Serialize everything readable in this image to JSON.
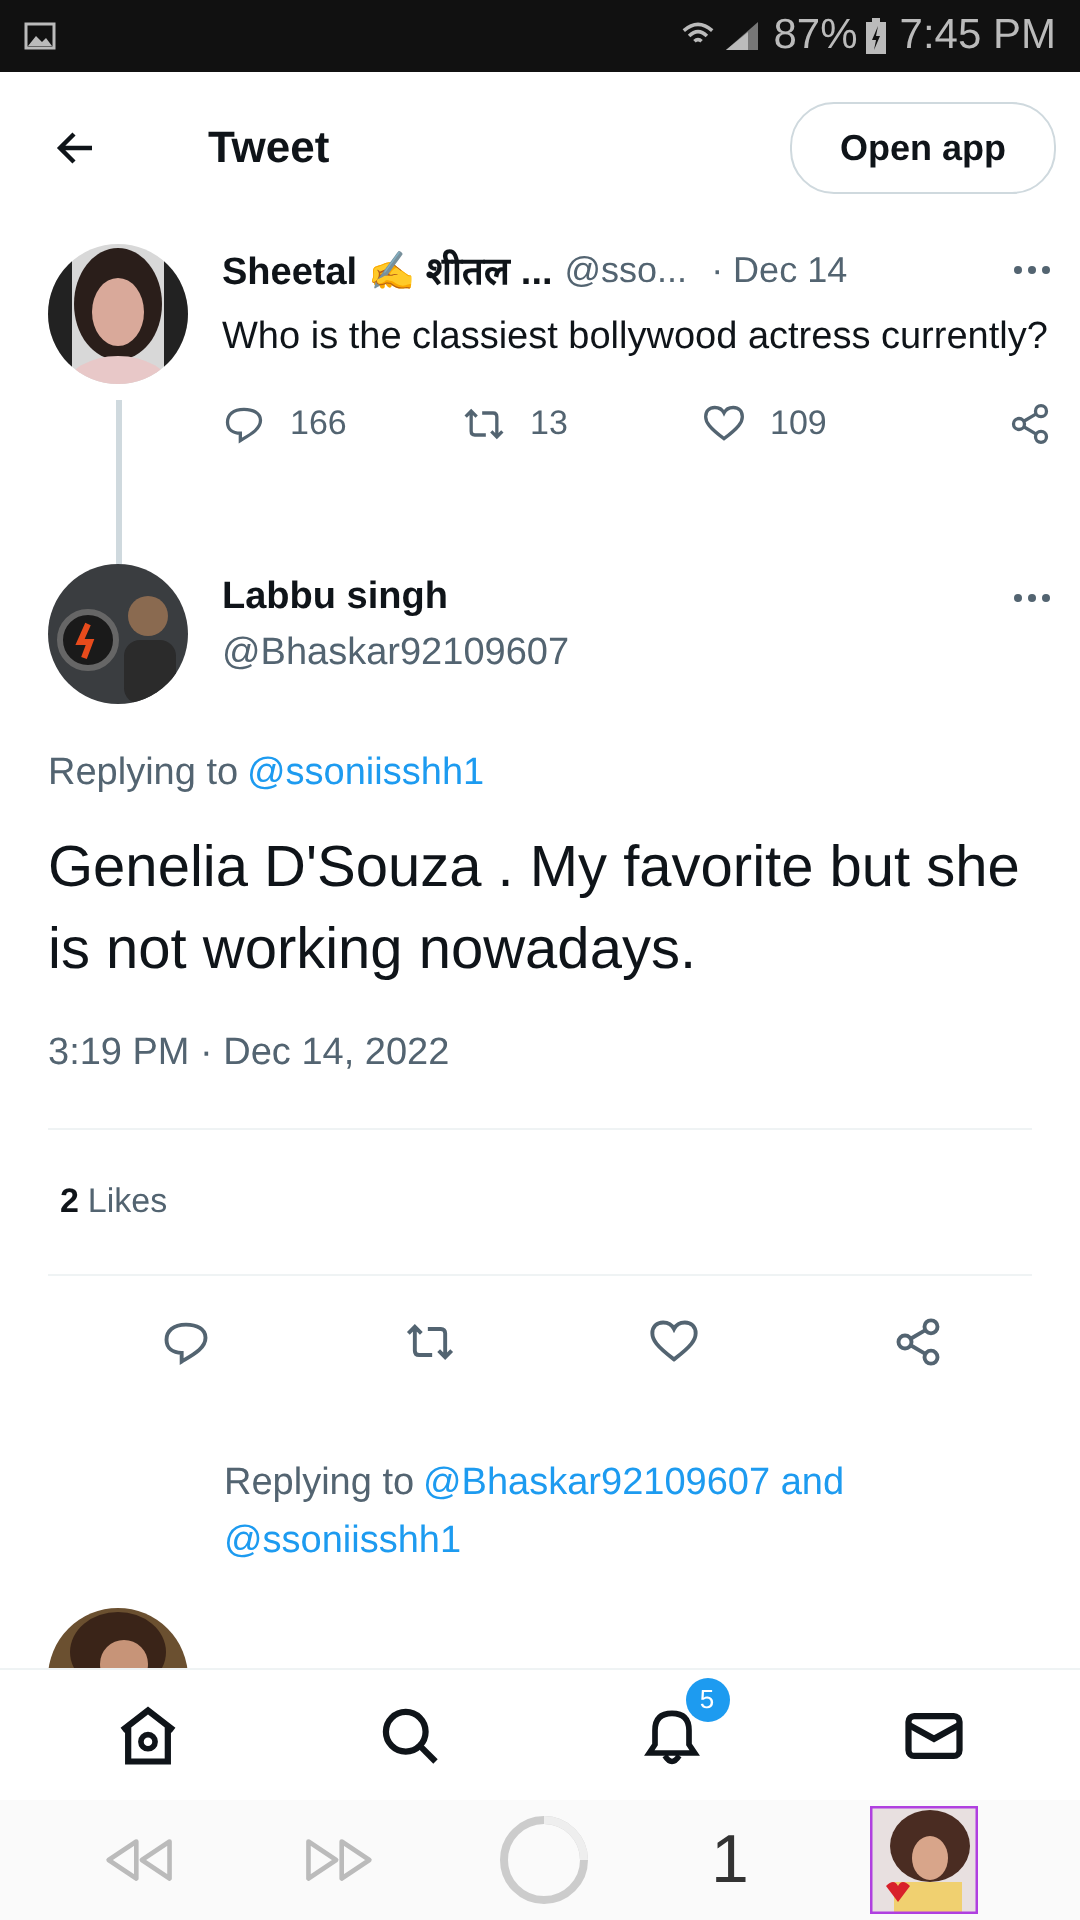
{
  "status_bar": {
    "battery": "87%",
    "time": "7:45 PM"
  },
  "header": {
    "title": "Tweet",
    "open_app": "Open app"
  },
  "parent_tweet": {
    "name": "Sheetal ✍️ शीतल ...",
    "handle": "@sso...",
    "date": "· Dec 14",
    "text": "Who is the classiest bollywood actress currently?",
    "replies": "166",
    "retweets": "13",
    "likes": "109"
  },
  "tweet": {
    "name": "Labbu singh",
    "handle": "@Bhaskar92109607",
    "replying_prefix": "Replying to",
    "replying_to": "@ssoniisshh1",
    "text": "Genelia D'Souza . My favorite but she is not working nowadays.",
    "timestamp": "3:19 PM · Dec 14, 2022",
    "likes_count": "2",
    "likes_label": "Likes"
  },
  "reply": {
    "replying_prefix": "Replying to",
    "mentions": [
      "@Bhaskar92109607 and",
      "@ssoniisshh1"
    ]
  },
  "bottom_nav": {
    "notifications_badge": "5"
  },
  "browser_bar": {
    "tab_count": "1"
  }
}
